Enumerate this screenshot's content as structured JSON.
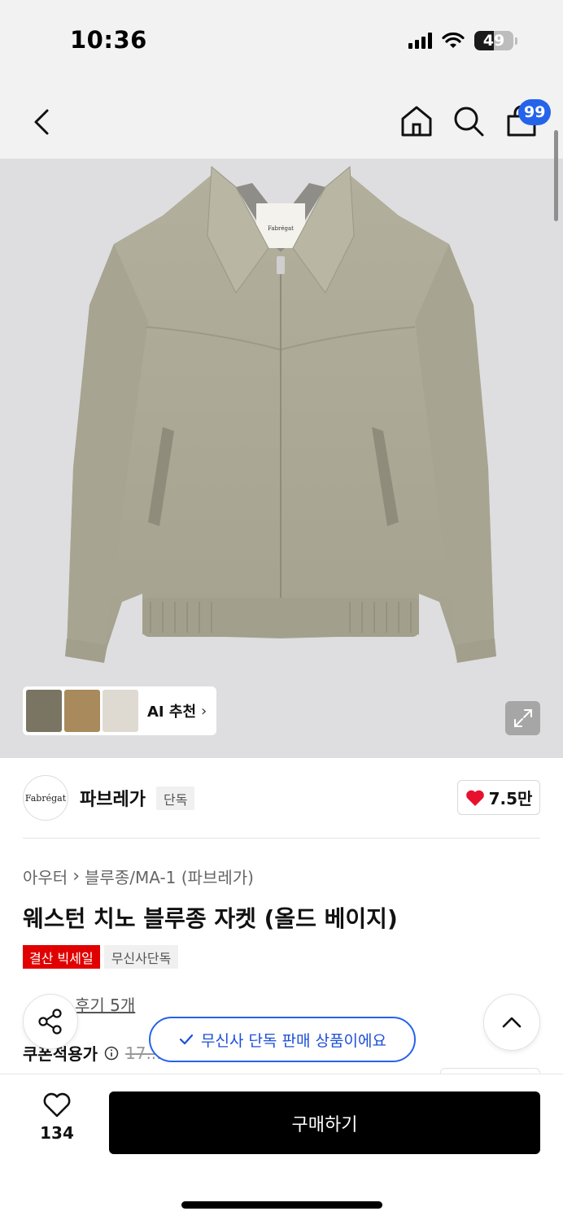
{
  "status_bar": {
    "time": "10:36",
    "battery": "49",
    "battery_level": 0.49
  },
  "nav": {
    "cart_badge": "99"
  },
  "image_overlay": {
    "ai_recommend_label": "AI 추천",
    "ai_thumbnail_colors": [
      "#7a7563",
      "#a88a5c",
      "#dedad1"
    ]
  },
  "brand": {
    "logo_text": "Fabrégat",
    "name": "파브레가",
    "tag": "단독",
    "like_count": "7.5만"
  },
  "breadcrumb": {
    "category": "아우터",
    "subcategory": "블루종/MA-1 (파브레가)"
  },
  "product": {
    "title": "웨스턴 치노 블루종 자켓 (올드 베이지)",
    "tags": [
      "결산 빅세일",
      "무신사단독"
    ],
    "review_text": "후기 5개",
    "price_label": "쿠폰적용가",
    "old_price": "17..."
  },
  "toast": {
    "text": "무신사 단독 판매 상품이에요"
  },
  "bottom_bar": {
    "wish_count": "134",
    "buy_label": "구매하기"
  },
  "colors": {
    "accent_blue": "#2563eb",
    "sale_red": "#e10000",
    "heart_red": "#e8112d",
    "jacket": "#aeab98"
  }
}
